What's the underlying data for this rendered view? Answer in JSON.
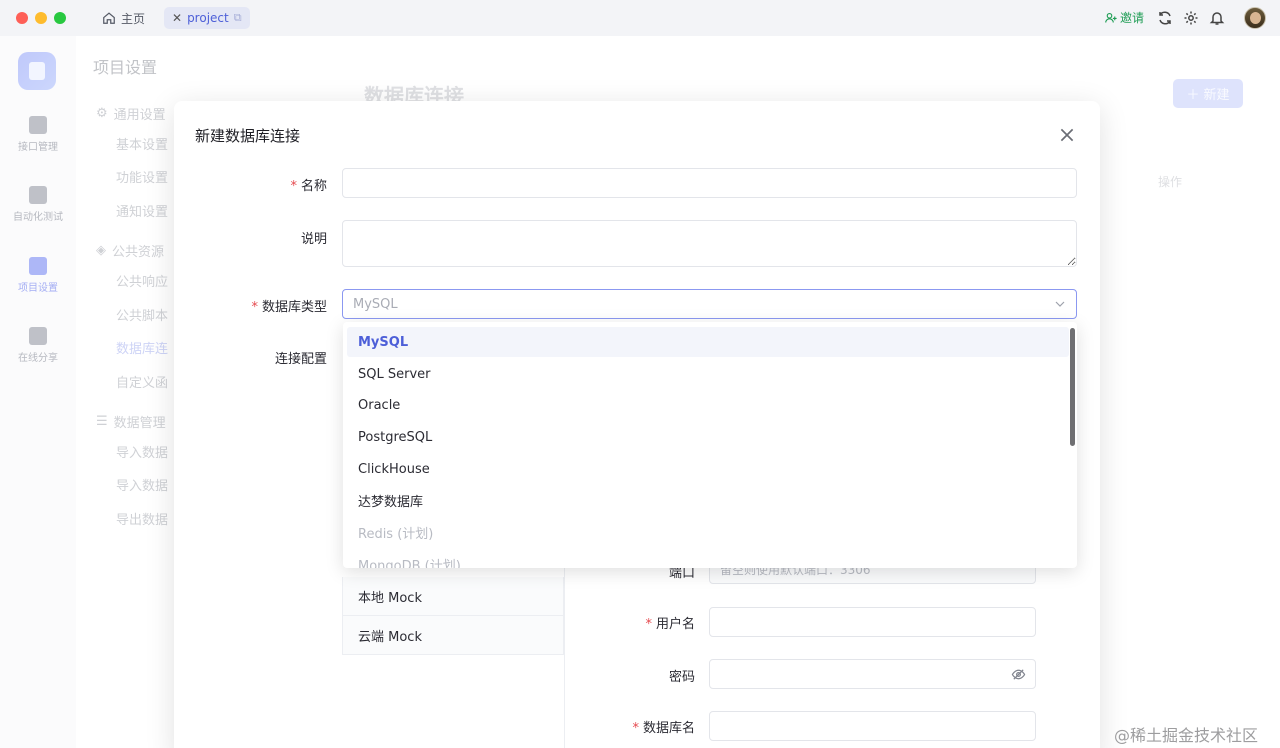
{
  "titlebar": {
    "home_tab": "主页",
    "project_tab": "project",
    "invite_label": "邀请"
  },
  "rail": {
    "items": [
      {
        "label": "接口管理",
        "icon": "api-icon"
      },
      {
        "label": "自动化测试",
        "icon": "automation-icon"
      },
      {
        "label": "项目设置",
        "icon": "settings-panel-icon"
      },
      {
        "label": "在线分享",
        "icon": "share-icon"
      }
    ],
    "active_index": 2
  },
  "sidebar": {
    "title": "项目设置",
    "groups": [
      {
        "label": "通用设置",
        "items": [
          "基本设置",
          "功能设置",
          "通知设置"
        ]
      },
      {
        "label": "公共资源",
        "items": [
          "公共响应",
          "公共脚本",
          "数据库连",
          "自定义函"
        ]
      },
      {
        "label": "数据管理",
        "items": [
          "导入数据",
          "导入数据",
          "导出数据"
        ]
      }
    ]
  },
  "background": {
    "heading": "数据库连接",
    "new_button": "新建",
    "operation_column": "操作"
  },
  "modal": {
    "title": "新建数据库连接",
    "fields": {
      "name_label": "名称",
      "name_value": "",
      "desc_label": "说明",
      "desc_value": "",
      "db_type_label": "数据库类型",
      "db_type_value": "MySQL",
      "conn_config_label": "连接配置"
    },
    "config_tabs": [
      "本地 Mock",
      "云端 Mock"
    ],
    "config_fields": {
      "port_label": "端口",
      "port_placeholder": "留空则使用默认端口：3306",
      "username_label": "用户名",
      "password_label": "密码",
      "dbname_label": "数据库名"
    }
  },
  "dropdown": {
    "options": [
      {
        "label": "MySQL",
        "state": "selected"
      },
      {
        "label": "SQL Server",
        "state": "normal"
      },
      {
        "label": "Oracle",
        "state": "normal"
      },
      {
        "label": "PostgreSQL",
        "state": "normal"
      },
      {
        "label": "ClickHouse",
        "state": "normal"
      },
      {
        "label": "达梦数据库",
        "state": "normal"
      },
      {
        "label": "Redis (计划)",
        "state": "disabled"
      },
      {
        "label": "MongoDB (计划)",
        "state": "disabled"
      }
    ]
  },
  "watermark": "@稀土掘金技术社区",
  "colors": {
    "accent": "#4d5fd8",
    "required": "#e5484d",
    "invite": "#1f9d55"
  }
}
